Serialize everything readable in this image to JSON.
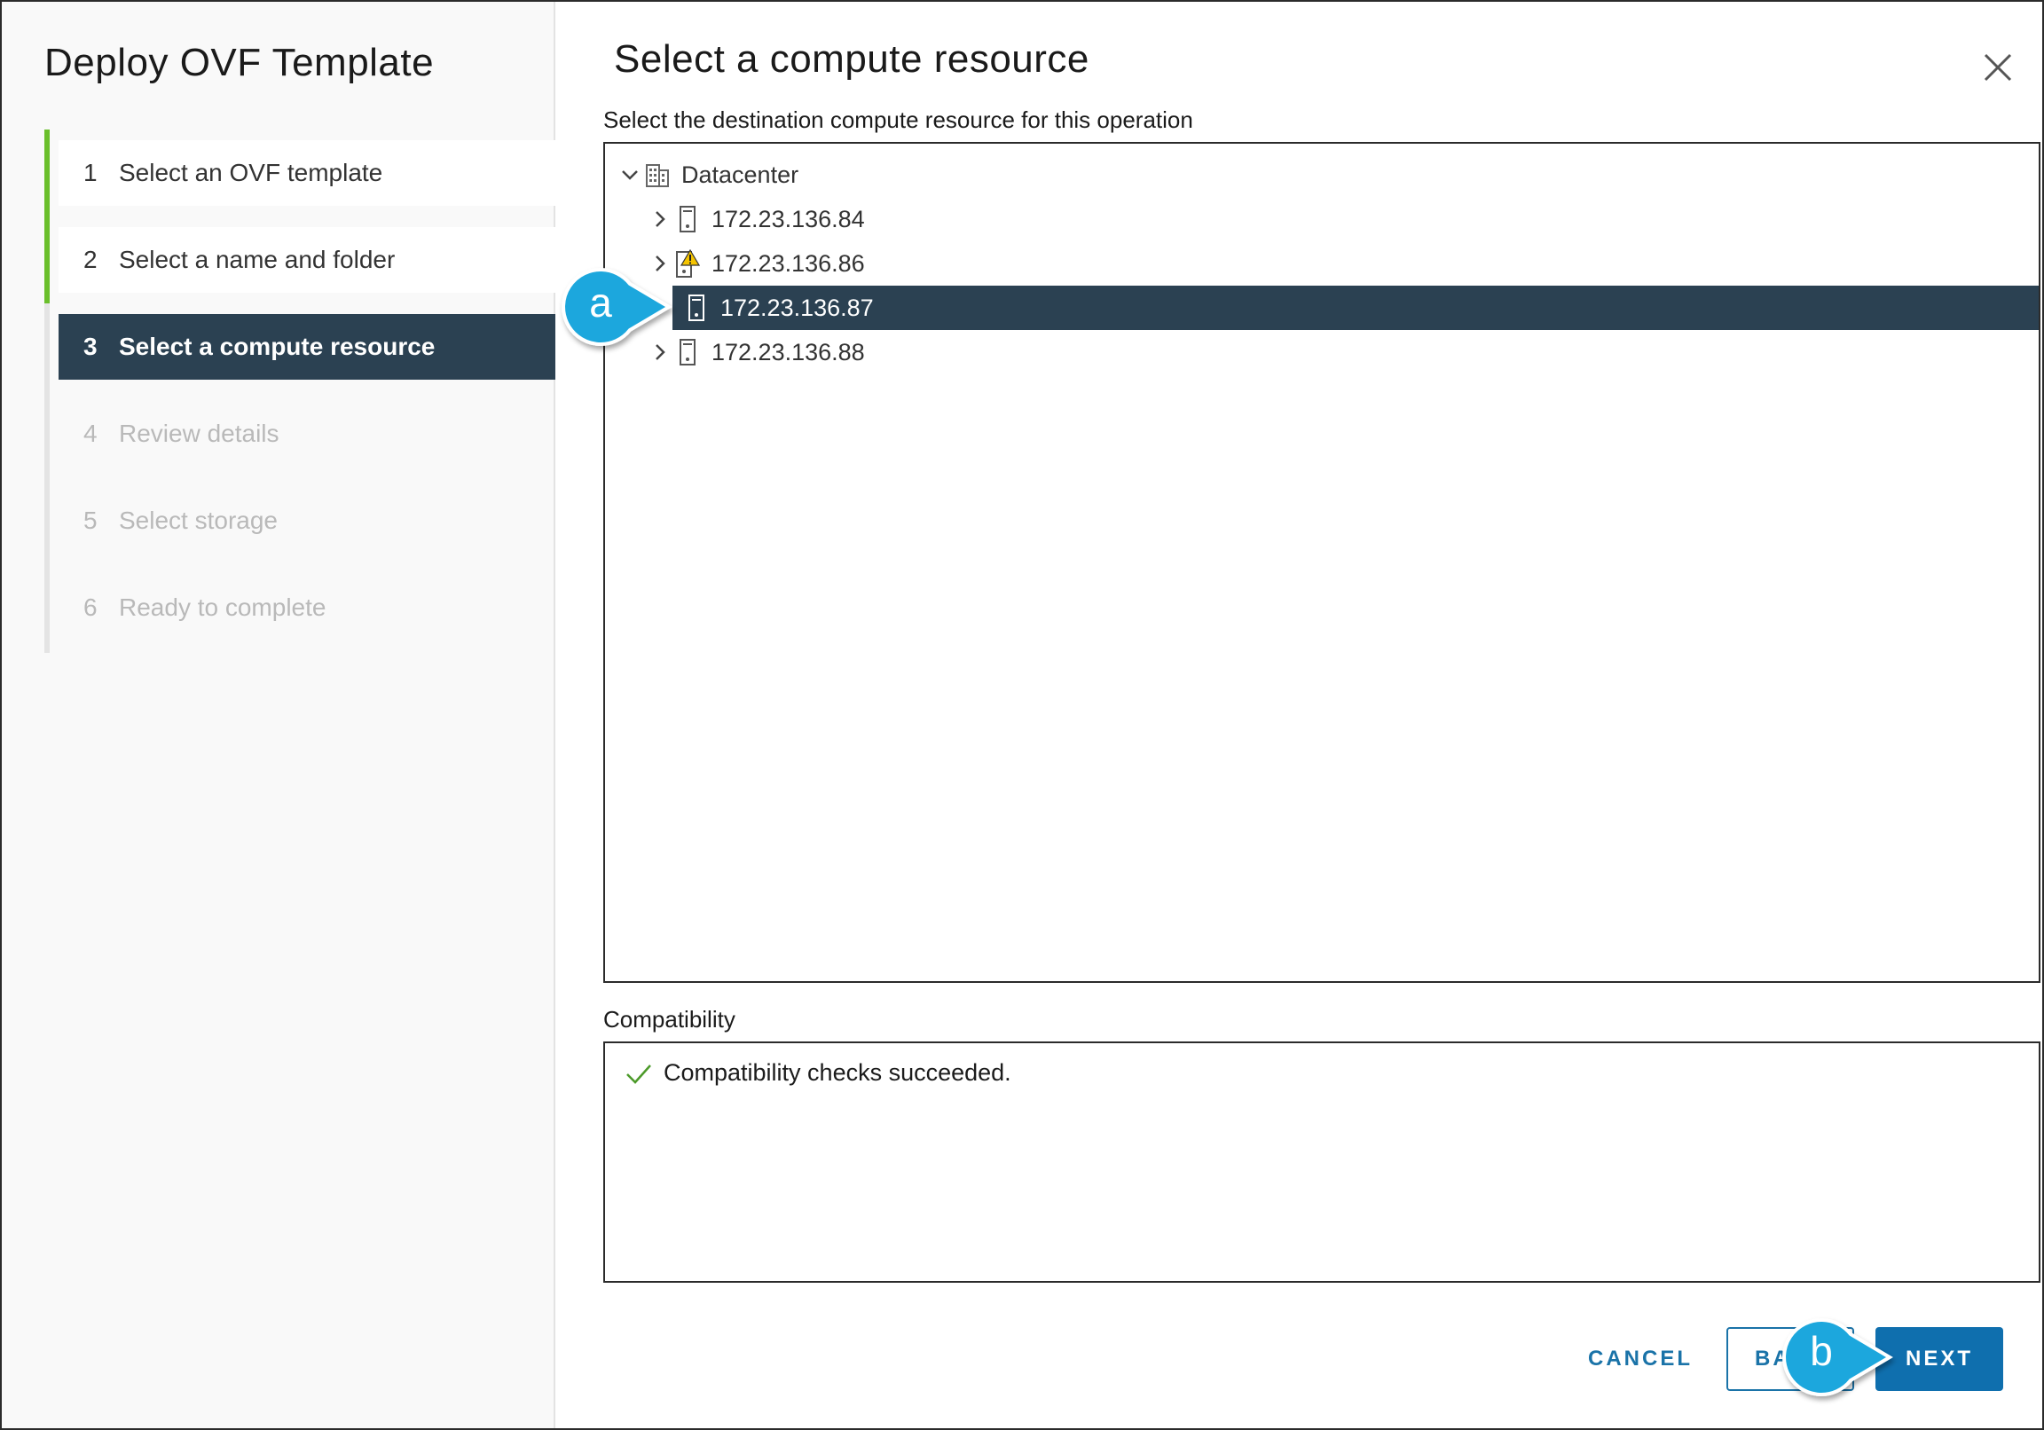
{
  "wizard": {
    "title": "Deploy OVF Template",
    "steps": [
      {
        "num": "1",
        "label": "Select an OVF template",
        "state": "done"
      },
      {
        "num": "2",
        "label": "Select a name and folder",
        "state": "done"
      },
      {
        "num": "3",
        "label": "Select a compute resource",
        "state": "active"
      },
      {
        "num": "4",
        "label": "Review details",
        "state": "todo"
      },
      {
        "num": "5",
        "label": "Select storage",
        "state": "todo"
      },
      {
        "num": "6",
        "label": "Ready to complete",
        "state": "todo"
      }
    ]
  },
  "page": {
    "title": "Select a compute resource",
    "subtitle": "Select the destination compute resource for this operation",
    "close_icon": "close-icon"
  },
  "tree": {
    "root": {
      "label": "Datacenter",
      "icon": "datacenter-icon",
      "expanded": true
    },
    "hosts": [
      {
        "label": "172.23.136.84",
        "icon": "host-icon",
        "selected": false,
        "warning": false
      },
      {
        "label": "172.23.136.86",
        "icon": "host-warning-icon",
        "selected": false,
        "warning": true
      },
      {
        "label": "172.23.136.87",
        "icon": "host-icon",
        "selected": true,
        "warning": false
      },
      {
        "label": "172.23.136.88",
        "icon": "host-icon",
        "selected": false,
        "warning": false
      }
    ]
  },
  "compatibility": {
    "label": "Compatibility",
    "message": "Compatibility checks succeeded.",
    "icon": "checkmark-icon"
  },
  "footer": {
    "cancel_label": "CANCEL",
    "back_label": "BACK",
    "back_visible_label": "BA",
    "next_label": "NEXT"
  },
  "callouts": {
    "a": "a",
    "b": "b"
  },
  "colors": {
    "nav_active_bg": "#2b4152",
    "nav_done_rail": "#6abf2b",
    "primary_button": "#0f6fae",
    "link_blue": "#1a73a8",
    "callout_blue": "#1aa7dd",
    "warning_yellow": "#f5c400",
    "check_green": "#4c9a2a"
  }
}
